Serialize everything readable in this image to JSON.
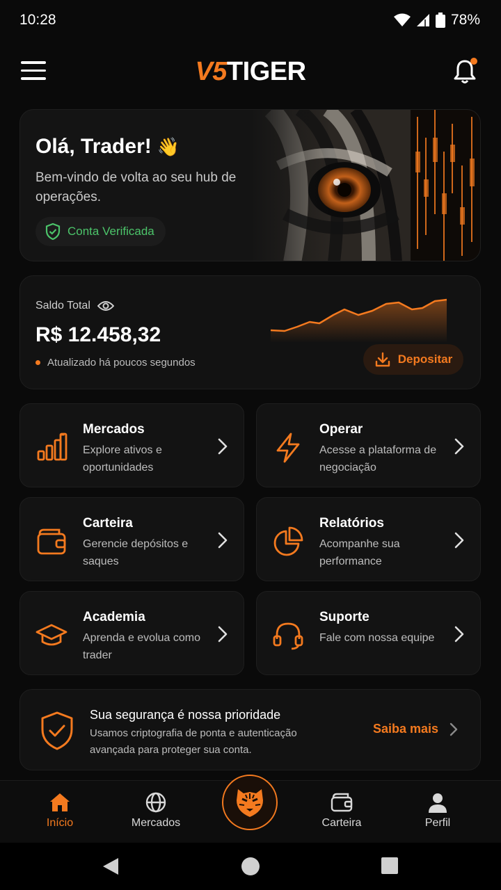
{
  "status": {
    "time": "10:28",
    "battery": "78%"
  },
  "header": {
    "logo_part1": "V5",
    "logo_part2": "TIGER"
  },
  "hero": {
    "title": "Olá, Trader!",
    "emoji": "👋",
    "subtitle": "Bem-vindo de volta ao seu hub de operações.",
    "badge": "Conta Verificada"
  },
  "balance": {
    "label": "Saldo Total",
    "value": "R$ 12.458,32",
    "updated": "Atualizado há poucos segundos",
    "deposit_label": "Depositar"
  },
  "tiles": [
    {
      "title": "Mercados",
      "desc": "Explore ativos e oportunidades",
      "icon": "bar-chart-icon"
    },
    {
      "title": "Operar",
      "desc": "Acesse a plataforma de negociação",
      "icon": "lightning-icon"
    },
    {
      "title": "Carteira",
      "desc": "Gerencie depósitos e saques",
      "icon": "wallet-icon"
    },
    {
      "title": "Relatórios",
      "desc": "Acompanhe sua performance",
      "icon": "pie-chart-icon"
    },
    {
      "title": "Academia",
      "desc": "Aprenda e evolua como trader",
      "icon": "graduation-cap-icon"
    },
    {
      "title": "Suporte",
      "desc": "Fale com nossa equipe",
      "icon": "headset-icon"
    }
  ],
  "security": {
    "title": "Sua segurança é nossa prioridade",
    "desc": "Usamos criptografia de ponta e autenticação avançada para proteger sua conta.",
    "link": "Saiba mais"
  },
  "nav": {
    "items": [
      {
        "label": "Início",
        "icon": "home-icon"
      },
      {
        "label": "Mercados",
        "icon": "globe-icon"
      },
      {
        "label": "Carteira",
        "icon": "wallet-icon"
      },
      {
        "label": "Perfil",
        "icon": "user-icon"
      }
    ]
  },
  "colors": {
    "accent": "#f47a1f",
    "background": "#0a0a0a",
    "card": "#131313",
    "success": "#4cc46a"
  }
}
